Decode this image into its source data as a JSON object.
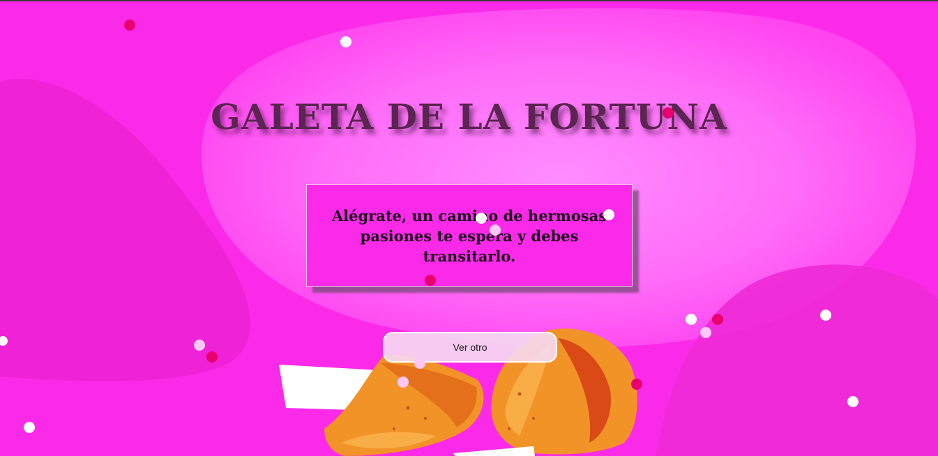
{
  "page": {
    "title": "GALETA DE LA FORTUNA"
  },
  "fortune": {
    "message": "Alégrate, un camino de hermosas pasiones te espera y debes transitarlo."
  },
  "actions": {
    "next_label": "Ver otro"
  },
  "colors": {
    "background": "#fb2ae8",
    "title": "#5a2550",
    "card": "#fb2ae8",
    "confetti_pink": "#e8006e",
    "confetti_white": "#ffffff"
  },
  "decorations": {
    "confetti": "confetti-particles",
    "illustration": "fortune-cookies"
  }
}
